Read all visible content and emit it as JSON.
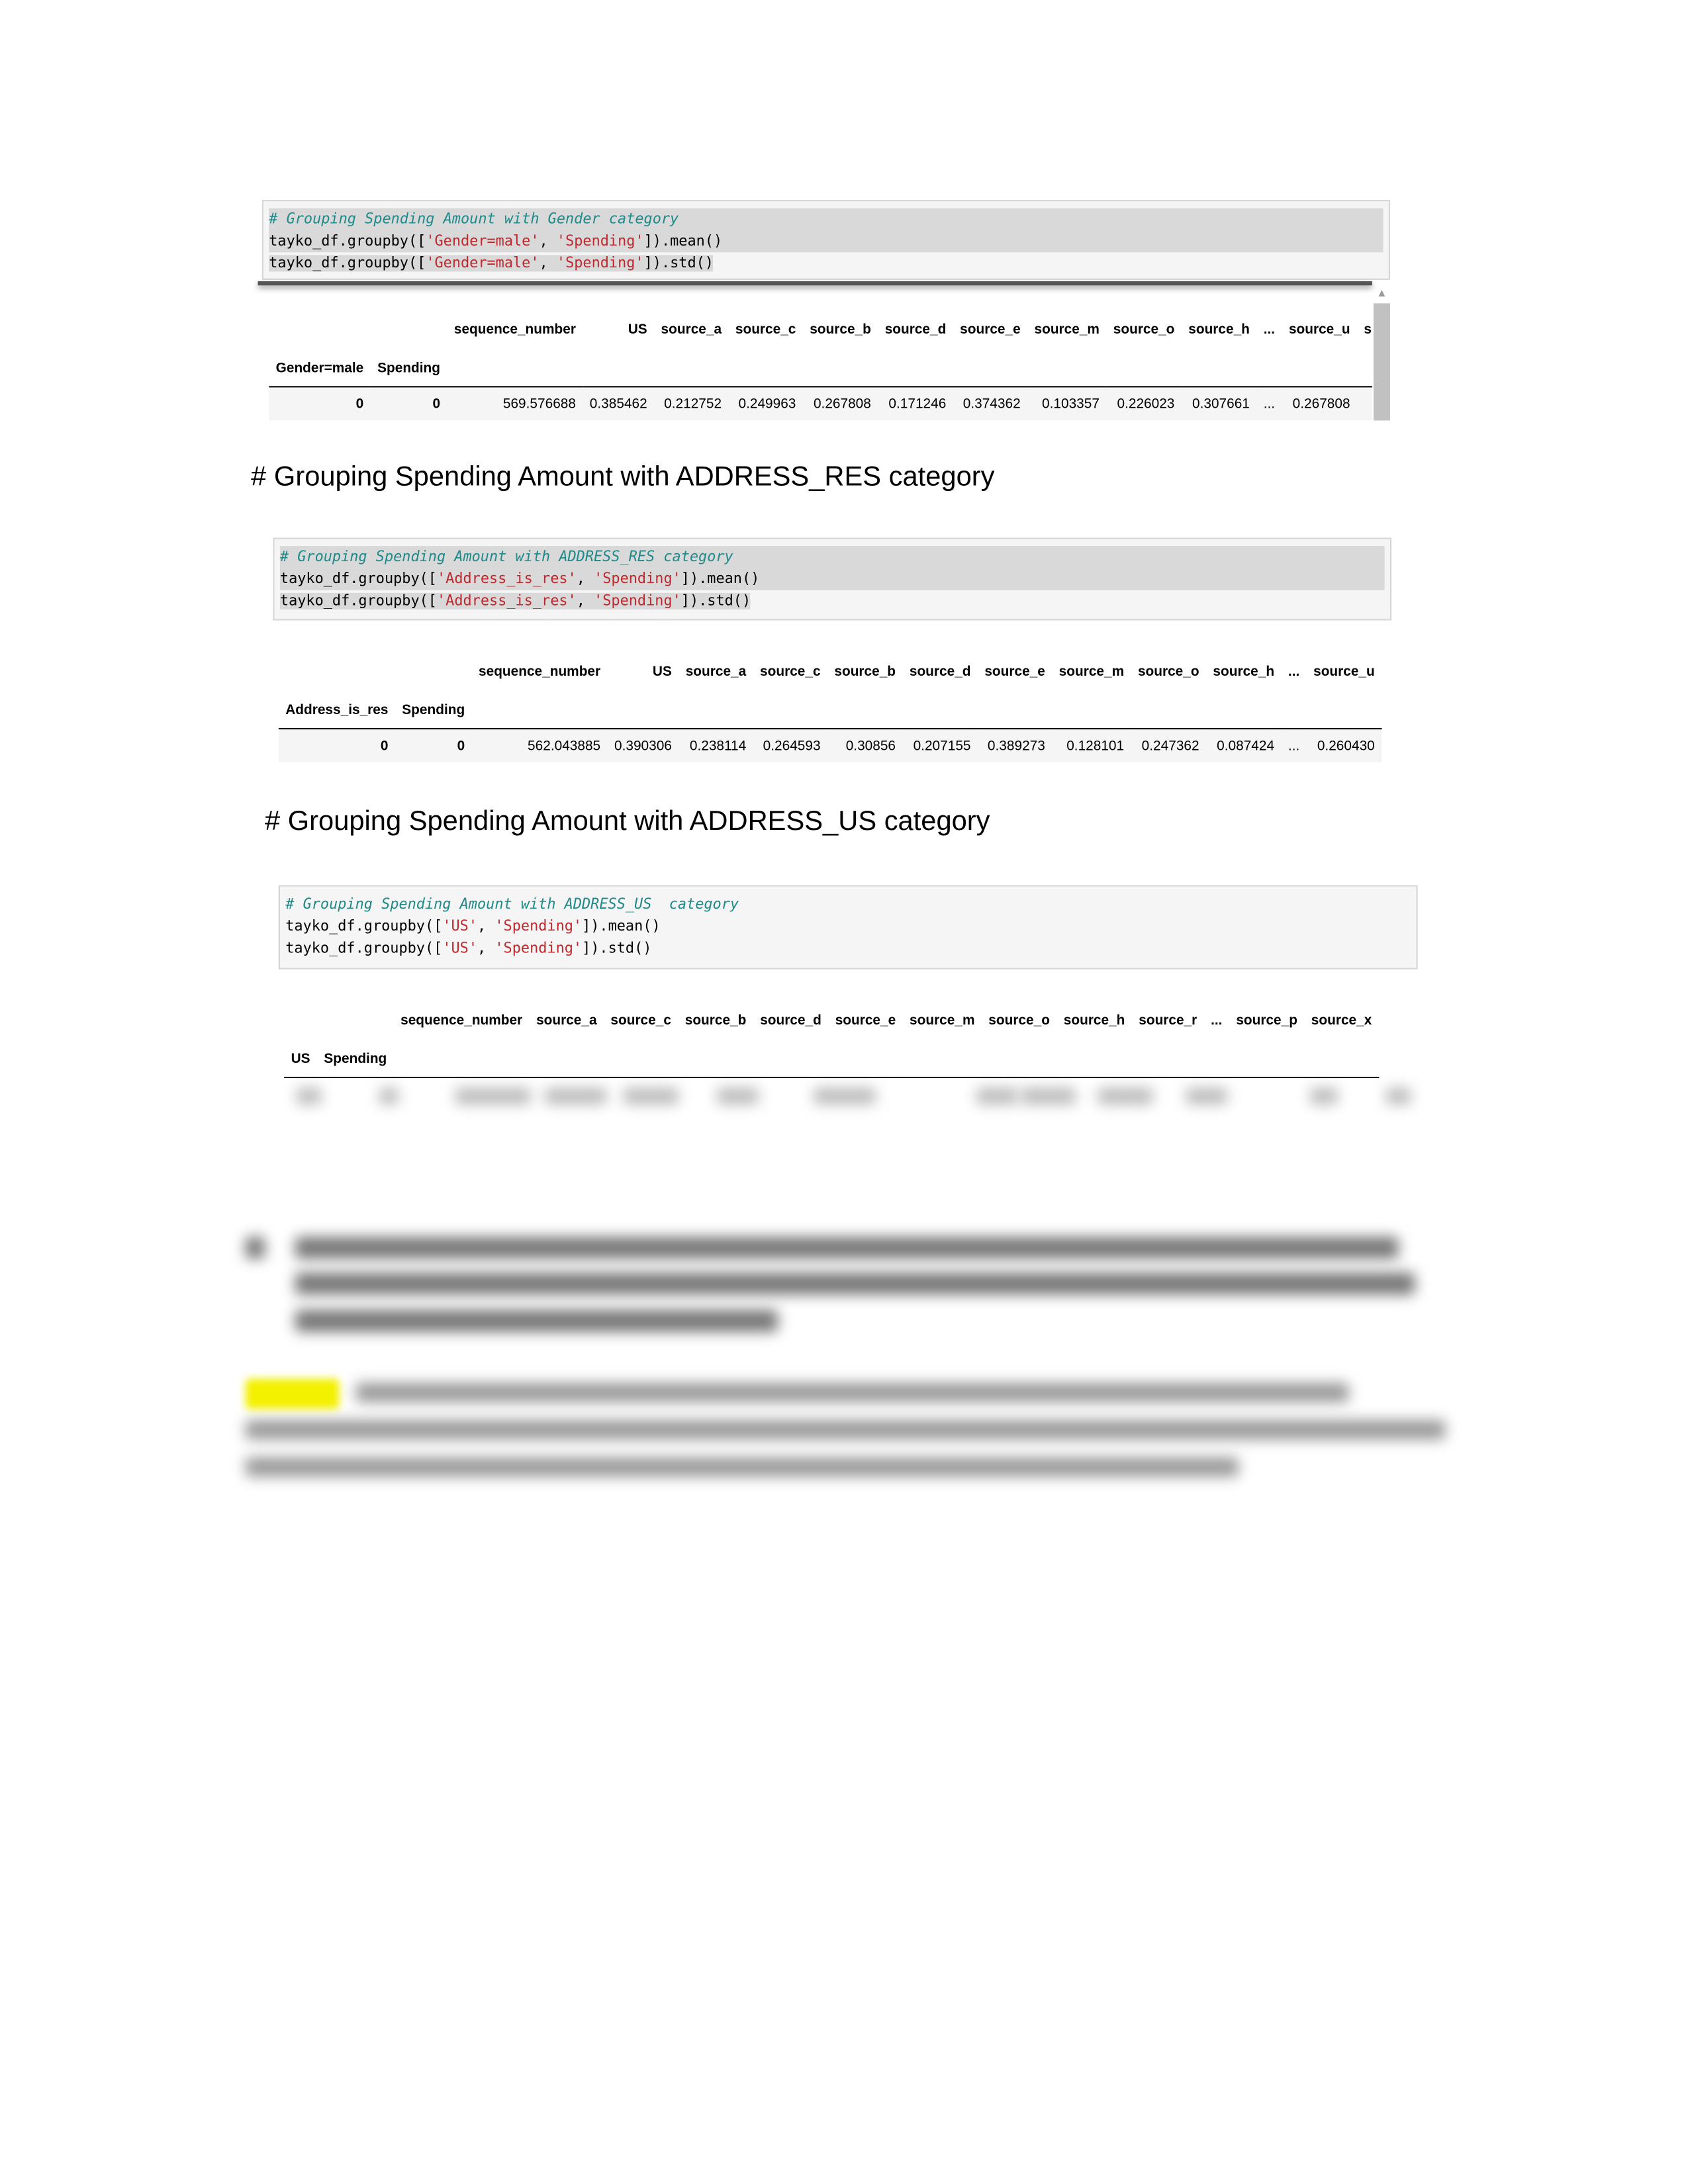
{
  "section1": {
    "code": {
      "comment": "# Grouping Spending Amount with Gender category",
      "line1_prefix": "tayko_df.groupby([",
      "line1_arg1": "'Gender=male'",
      "line1_sep": ", ",
      "line1_arg2": "'Spending'",
      "line1_suffix": "]).mean()",
      "line2_prefix": "tayko_df.groupby([",
      "line2_arg1": "'Gender=male'",
      "line2_sep": ", ",
      "line2_arg2": "'Spending'",
      "line2_suffix": "]).std()"
    },
    "table": {
      "columns": [
        "sequence_number",
        "US",
        "source_a",
        "source_c",
        "source_b",
        "source_d",
        "source_e",
        "source_m",
        "source_o",
        "source_h",
        "...",
        "source_u",
        "sou"
      ],
      "index_names": [
        "Gender=male",
        "Spending"
      ],
      "index_values": [
        "0",
        "0"
      ],
      "values": [
        "569.576688",
        "0.385462",
        "0.212752",
        "0.249963",
        "0.267808",
        "0.171246",
        "0.374362",
        "0.103357",
        "0.226023",
        "0.307661",
        "...",
        "0.267808",
        ""
      ]
    }
  },
  "heading2": "# Grouping Spending Amount with ADDRESS_RES category",
  "section2": {
    "code": {
      "comment": "# Grouping Spending Amount with ADDRESS_RES category",
      "line1_prefix": "tayko_df.groupby([",
      "line1_arg1": "'Address_is_res'",
      "line1_sep": ", ",
      "line1_arg2": "'Spending'",
      "line1_suffix": "]).mean()",
      "line2_prefix": "tayko_df.groupby([",
      "line2_arg1": "'Address_is_res'",
      "line2_sep": ", ",
      "line2_arg2": "'Spending'",
      "line2_suffix": "]).std()"
    },
    "table": {
      "columns": [
        "sequence_number",
        "US",
        "source_a",
        "source_c",
        "source_b",
        "source_d",
        "source_e",
        "source_m",
        "source_o",
        "source_h",
        "...",
        "source_u"
      ],
      "index_names": [
        "Address_is_res",
        "Spending"
      ],
      "index_values": [
        "0",
        "0"
      ],
      "values": [
        "562.043885",
        "0.390306",
        "0.238114",
        "0.264593",
        "0.30856",
        "0.207155",
        "0.389273",
        "0.128101",
        "0.247362",
        "0.087424",
        "...",
        "0.260430"
      ]
    }
  },
  "heading3": "# Grouping Spending Amount with ADDRESS_US category",
  "section3": {
    "code": {
      "comment": "# Grouping Spending Amount with ADDRESS_US  category",
      "line1_prefix": "tayko_df.groupby([",
      "line1_arg1": "'US'",
      "line1_sep": ", ",
      "line1_arg2": "'Spending'",
      "line1_suffix": "]).mean()",
      "line2_prefix": "tayko_df.groupby([",
      "line2_arg1": "'US'",
      "line2_sep": ", ",
      "line2_arg2": "'Spending'",
      "line2_suffix": "]).std()"
    },
    "table": {
      "columns": [
        "sequence_number",
        "source_a",
        "source_c",
        "source_b",
        "source_d",
        "source_e",
        "source_m",
        "source_o",
        "source_h",
        "source_r",
        "...",
        "source_p",
        "source_x"
      ],
      "index_names": [
        "US",
        "Spending"
      ]
    }
  },
  "colors": {
    "comment": "#1f8a8a",
    "string": "#c0282d",
    "highlight": "#f3f000"
  }
}
